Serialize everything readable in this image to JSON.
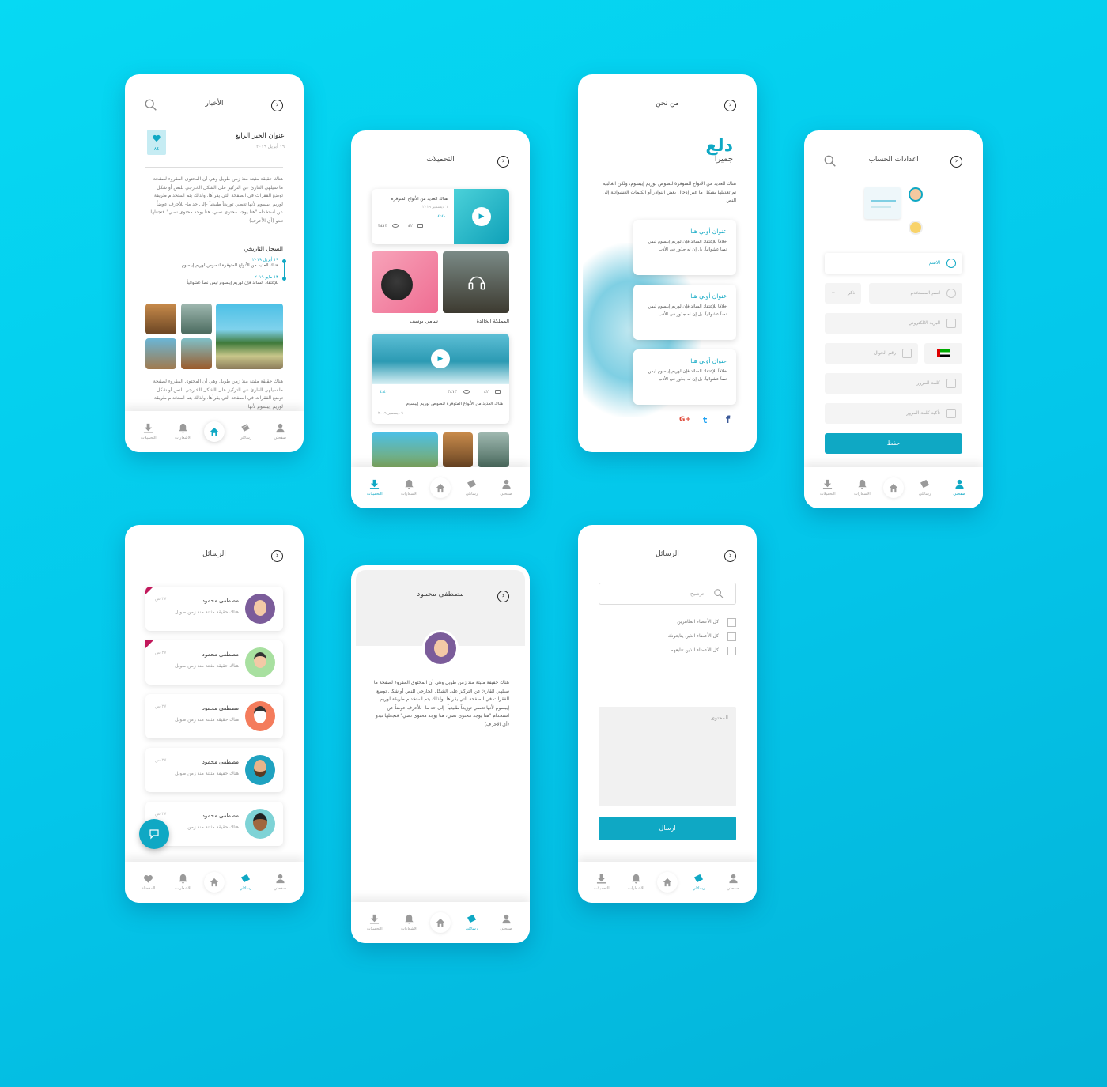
{
  "nav": {
    "profile": "صفحتي",
    "messages": "رسائلي",
    "notifications": "الاشعارات",
    "downloads": "التحميلات",
    "favorites": "المفضلة"
  },
  "news": {
    "title": "الأخبار",
    "article_title": "عنوان الخبر الرابع",
    "article_date": "١٩ أبريل ٢٠١٩",
    "like_count": "٨٤",
    "body": "هناك حقيقة مثبتة منذ زمن طويل وهي أن المحتوى المقروء لصفحة ما سيلهي القارئ عن التركيز على الشكل الخارجي للنص أو شكل توضع الفقرات في الصفحة التي يقرأها. ولذلك يتم استخدام طريقة لوريم إيبسوم لأنها تعطي توزيعاَ طبيعياَ -إلى حد ما- للأحرف عوضاً عن استخدام \"هنا يوجد محتوى نصي، هنا يوجد محتوى نصي\" فتجعلها تبدو (أي الأحرف)",
    "history_title": "السجل التاريخي",
    "history": [
      {
        "date": "١٩ أبريل ٢٠١٩",
        "text": "هناك العديد من الأنواع المتوفرة لنصوص لوريم إيبسوم"
      },
      {
        "date": "١٣ مايو ٢٠١٩",
        "text": "للإعتقاد السائد فإن لوريم إيبسوم ليس نصاَ عشوائياً"
      }
    ],
    "body2": "هناك حقيقة مثبتة منذ زمن طويل وهي أن المحتوى المقروء لصفحة ما سيلهي القارئ عن التركيز على الشكل الخارجي للنص أو شكل توضع الفقرات في الصفحة التي يقرأها. ولذلك يتم استخدام طريقة لوريم إيبسوم لأنها"
  },
  "downloads": {
    "title": "التحميلات",
    "video1": {
      "title": "هناك العديد من الأنواع المتوفرة",
      "date": "٦ ديسمبر ٢٠١٩",
      "duration": "٤:٤٠",
      "views": "٣٤١٣",
      "comments": "٤٢"
    },
    "tile1": "سامي يوسف",
    "tile2": "المملكة الخالدة",
    "video2": {
      "duration": "٤:٤٠",
      "views": "٣٤١٣",
      "comments": "٤٢",
      "desc": "هناك العديد من الأنواع المتوفرة لنصوص لوريم إيبسوم",
      "date": "٦ ديسمبر ٢٠١٩"
    }
  },
  "about": {
    "title": "من نحن",
    "logo_line1": "دلع",
    "logo_line2": "جميرا",
    "intro": "هناك العديد من الأنواع المتوفرة لنصوص لوريم إيبسوم، ولكن الغالبية تم تعديلها بشكل ما عبر إدخال بعض النوادر أو الكلمات العشوائية إلى النص",
    "cards": [
      {
        "title": "عنوان أولي هنا",
        "text": "خلافاَ للإعتقاد السائد فإن لوريم إيبسوم ليس نصاَ عشوائياً، بل إن له جذور في الأدب"
      },
      {
        "title": "عنوان أولي هنا",
        "text": "خلافاَ للإعتقاد السائد فإن لوريم إيبسوم ليس نصاَ عشوائياً، بل إن له جذور في الأدب"
      },
      {
        "title": "عنوان أولي هنا",
        "text": "خلافاَ للإعتقاد السائد فإن لوريم إيبسوم ليس نصاَ عشوائياً، بل إن له جذور في الأدب"
      }
    ],
    "social": {
      "google": "G+",
      "twitter": "t",
      "facebook": "f"
    }
  },
  "account": {
    "title": "اعدادات الحساب",
    "name": "الاسم",
    "username": "اسم المستخدم",
    "gender": "ذكر",
    "email": "البريد الالكتروني",
    "phone": "رقم الجوال",
    "password": "كلمة المرور",
    "confirm": "تأكيد كلمة المرور",
    "save": "حفظ"
  },
  "messages": {
    "title": "الرسائل",
    "items": [
      {
        "name": "مصطفى محمود",
        "preview": "هناك حقيقة مثبتة منذ زمن طويل",
        "time": "٢٧ س"
      },
      {
        "name": "مصطفى محمود",
        "preview": "هناك حقيقة مثبتة منذ زمن طويل",
        "time": "٢٧ س"
      },
      {
        "name": "مصطفى محمود",
        "preview": "هناك حقيقة مثبتة منذ زمن طويل",
        "time": "٢٧ س"
      },
      {
        "name": "مصطفى محمود",
        "preview": "هناك حقيقة مثبتة منذ زمن طويل",
        "time": "٢٧ س"
      },
      {
        "name": "مصطفى محمود",
        "preview": "هناك حقيقة مثبتة منذ زمن",
        "time": "٢٧ س"
      }
    ]
  },
  "profile": {
    "name": "مصطفى محمود",
    "body": "هناك حقيقة مثبتة منذ زمن طويل وهي أن المحتوى المقروء لصفحة ما سيلهي القارئ عن التركيز على الشكل الخارجي للنص أو شكل توضع الفقرات في الصفحة التي يقرأها. ولذلك يتم استخدام طريقة لوريم إيبسوم لأنها تعطي توزيعاَ طبيعياَ -إلى حد ما- للأحرف عوضاً عن استخدام \"هنا يوجد محتوى نصي، هنا يوجد محتوى نصي\" فتجعلها تبدو (أي الأحرف)"
  },
  "compose": {
    "title": "الرسائل",
    "search_placeholder": "ترشيح",
    "options": [
      "كل الأعضاء الظاهرين",
      "كل الأعضاء الذين يتابعونك",
      "كل الأعضاء الذين تتابعهم"
    ],
    "content_placeholder": "المحتوى",
    "send": "ارسال"
  },
  "colors": {
    "accent": "#0fa8c4",
    "background": "#04c6ea"
  }
}
